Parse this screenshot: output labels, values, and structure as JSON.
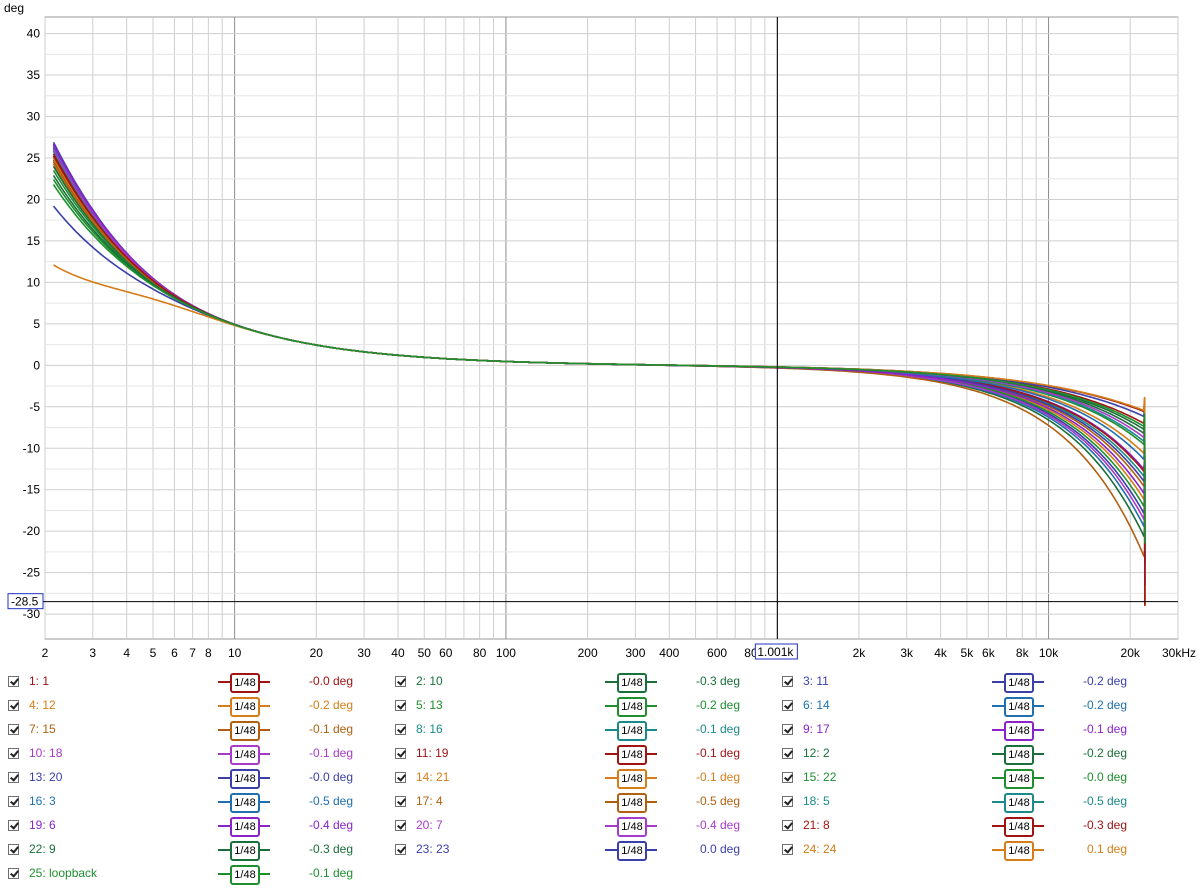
{
  "chart_data": {
    "type": "line",
    "ylabel": "deg",
    "xunit": "kHz",
    "xscale": "log",
    "xlim": [
      2,
      30000
    ],
    "ylim": [
      -33,
      42
    ],
    "grid": true,
    "y_ticks": [
      40,
      35,
      30,
      25,
      20,
      15,
      10,
      5,
      0,
      -5,
      -10,
      -15,
      -20,
      -25,
      -30
    ],
    "x_ticks": [
      {
        "v": 2,
        "label": "2"
      },
      {
        "v": 3,
        "label": "3"
      },
      {
        "v": 4,
        "label": "4"
      },
      {
        "v": 5,
        "label": "5"
      },
      {
        "v": 6,
        "label": "6"
      },
      {
        "v": 7,
        "label": "7"
      },
      {
        "v": 8,
        "label": "8"
      },
      {
        "v": 10,
        "label": "10"
      },
      {
        "v": 20,
        "label": "20"
      },
      {
        "v": 30,
        "label": "30"
      },
      {
        "v": 40,
        "label": "40"
      },
      {
        "v": 50,
        "label": "50"
      },
      {
        "v": 60,
        "label": "60"
      },
      {
        "v": 80,
        "label": "80"
      },
      {
        "v": 100,
        "label": "100"
      },
      {
        "v": 200,
        "label": "200"
      },
      {
        "v": 300,
        "label": "300"
      },
      {
        "v": 400,
        "label": "400"
      },
      {
        "v": 600,
        "label": "600"
      },
      {
        "v": 800,
        "label": "80"
      },
      {
        "v": 2000,
        "label": "2k"
      },
      {
        "v": 3000,
        "label": "3k"
      },
      {
        "v": 4000,
        "label": "4k"
      },
      {
        "v": 5000,
        "label": "5k"
      },
      {
        "v": 6000,
        "label": "6k"
      },
      {
        "v": 8000,
        "label": "8k"
      },
      {
        "v": 10000,
        "label": "10k"
      },
      {
        "v": 20000,
        "label": "20k"
      },
      {
        "v": 30000,
        "label": "30kHz"
      }
    ],
    "cursor": {
      "x": 1001,
      "x_label": "1.001k",
      "y": -28.5,
      "y_label": "-28.5"
    },
    "series": [
      {
        "name": "1: 1",
        "color": "#a01414",
        "smoothing": "1/48",
        "value_label": "-0.0 deg",
        "start": 25.2,
        "hf": 0.0
      },
      {
        "name": "2: 10",
        "color": "#1a6f3a",
        "smoothing": "1/48",
        "value_label": "-0.3 deg",
        "start": 24.8,
        "hf": -12.5
      },
      {
        "name": "3: 11",
        "color": "#3b3fa8",
        "smoothing": "1/48",
        "value_label": "-0.2 deg",
        "start": 26.6,
        "hf": -10.2
      },
      {
        "name": "4: 12",
        "color": "#d57d18",
        "smoothing": "1/48",
        "value_label": "-0.2 deg",
        "start": 25.0,
        "hf": -8.8
      },
      {
        "name": "5: 13",
        "color": "#1e8f2e",
        "smoothing": "1/48",
        "value_label": "-0.2 deg",
        "start": 23.5,
        "hf": -9.5
      },
      {
        "name": "6: 14",
        "color": "#2070b0",
        "smoothing": "1/48",
        "value_label": "-0.2 deg",
        "start": 26.2,
        "hf": -11.5
      },
      {
        "name": "7: 15",
        "color": "#b06010",
        "smoothing": "1/48",
        "value_label": "-0.1 deg",
        "start": 24.3,
        "hf": -7.5
      },
      {
        "name": "8: 16",
        "color": "#1a8a8a",
        "smoothing": "1/48",
        "value_label": "-0.1 deg",
        "start": 25.8,
        "hf": -6.5
      },
      {
        "name": "9: 17",
        "color": "#8a24c8",
        "smoothing": "1/48",
        "value_label": "-0.1 deg",
        "start": 26.4,
        "hf": -5.8
      },
      {
        "name": "10: 18",
        "color": "#a83ac8",
        "smoothing": "1/48",
        "value_label": "-0.1 deg",
        "start": 26.0,
        "hf": -10.8
      },
      {
        "name": "11: 19",
        "color": "#a01414",
        "smoothing": "1/48",
        "value_label": "-0.1 deg",
        "start": 25.5,
        "hf": -6.0
      },
      {
        "name": "12: 2",
        "color": "#1a6f3a",
        "smoothing": "1/48",
        "value_label": "-0.2 deg",
        "start": 24.0,
        "hf": -2.2
      },
      {
        "name": "13: 20",
        "color": "#3b3fa8",
        "smoothing": "1/48",
        "value_label": "-0.0 deg",
        "start": 26.9,
        "hf": -7.0
      },
      {
        "name": "14: 21",
        "color": "#d57d18",
        "smoothing": "1/48",
        "value_label": "-0.1 deg",
        "start": 24.5,
        "hf": -4.2
      },
      {
        "name": "15: 22",
        "color": "#1e8f2e",
        "smoothing": "1/48",
        "value_label": "-0.0 deg",
        "start": 22.4,
        "hf": -3.3
      },
      {
        "name": "16: 3",
        "color": "#2070b0",
        "smoothing": "1/48",
        "value_label": "-0.5 deg",
        "start": 26.3,
        "hf": -4.8
      },
      {
        "name": "17: 4",
        "color": "#b06010",
        "smoothing": "1/48",
        "value_label": "-0.5 deg",
        "start": 24.6,
        "hf": -14.5
      },
      {
        "name": "18: 5",
        "color": "#1a8a8a",
        "smoothing": "1/48",
        "value_label": "-0.5 deg",
        "start": 25.9,
        "hf": -3.0
      },
      {
        "name": "19: 6",
        "color": "#8a24c8",
        "smoothing": "1/48",
        "value_label": "-0.4 deg",
        "start": 26.7,
        "hf": -8.2
      },
      {
        "name": "20: 7",
        "color": "#a83ac8",
        "smoothing": "1/48",
        "value_label": "-0.4 deg",
        "start": 26.1,
        "hf": -2.6
      },
      {
        "name": "21: 8",
        "color": "#a01414",
        "smoothing": "1/48",
        "value_label": "-0.3 deg",
        "start": 25.3,
        "hf": -1.2
      },
      {
        "name": "22: 9",
        "color": "#1a6f3a",
        "smoothing": "1/48",
        "value_label": "-0.3 deg",
        "start": 22.9,
        "hf": -1.8
      },
      {
        "name": "23: 23",
        "color": "#3b3fa8",
        "smoothing": "1/48",
        "value_label": "0.0 deg",
        "start": 19.2,
        "hf": -0.5
      },
      {
        "name": "24: 24",
        "color": "#d57d18",
        "smoothing": "1/48",
        "value_label": "0.1 deg",
        "start": 12.1,
        "hf": 0.1
      },
      {
        "name": "25: loopback",
        "color": "#1e8f2e",
        "smoothing": "1/48",
        "value_label": "-0.1 deg",
        "start": 21.8,
        "hf": -1.5
      }
    ]
  }
}
